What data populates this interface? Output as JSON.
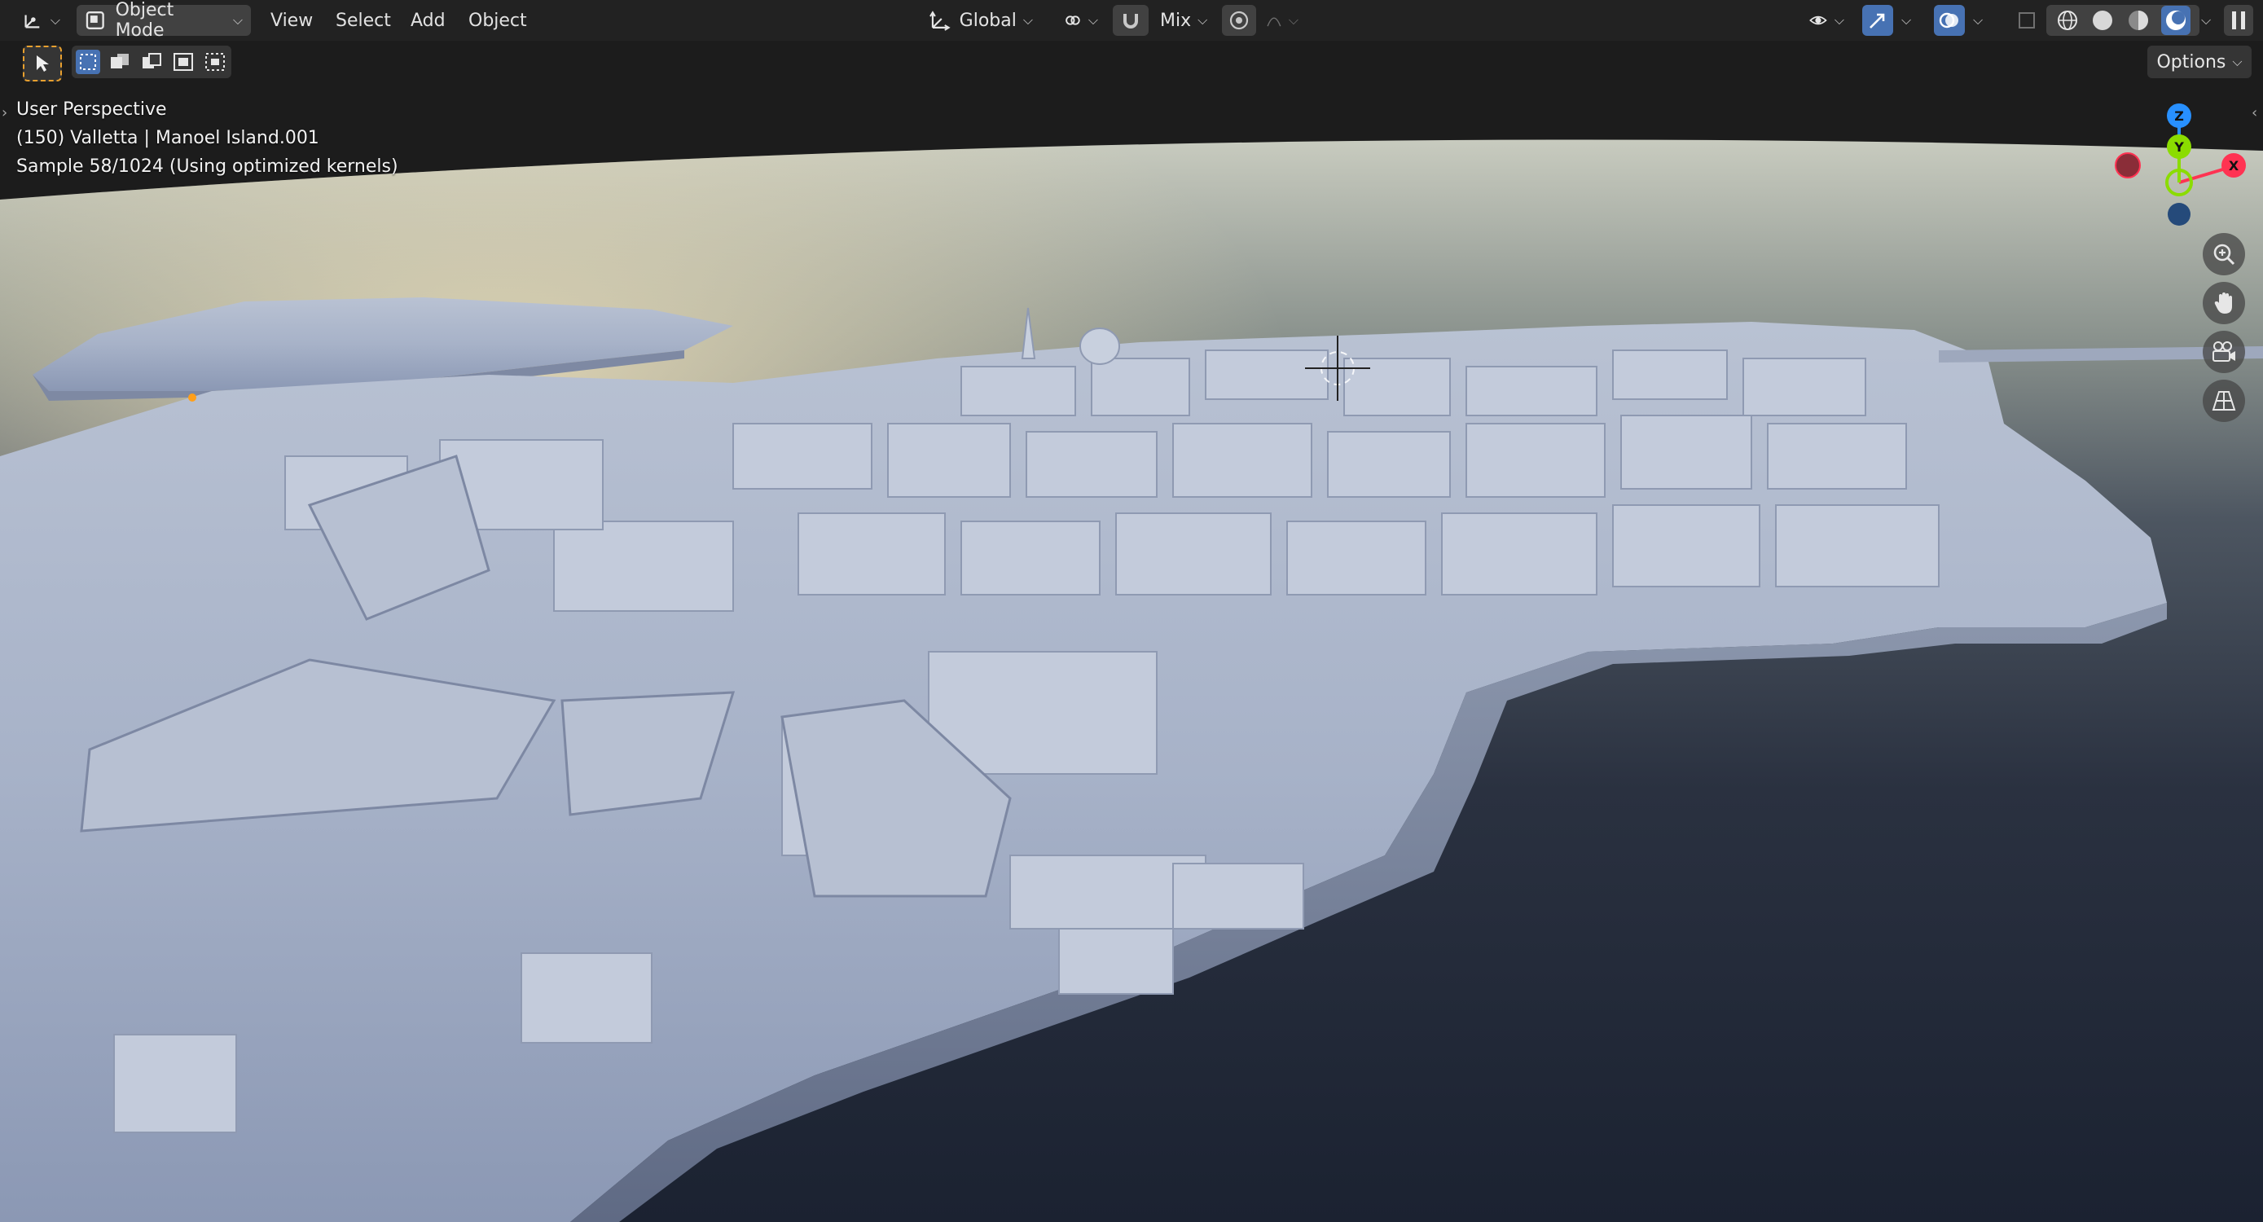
{
  "header": {
    "editor_type_icon": "axes-editor-icon",
    "mode_label": "Object Mode",
    "menus": [
      "View",
      "Select",
      "Add",
      "Object"
    ],
    "transform_orientation": "Global",
    "snap_mode": "Mix",
    "viewport_options_label": "Options"
  },
  "viewport": {
    "view_name": "User Perspective",
    "object_info": "(150) Valletta | Manoel Island.001",
    "render_status": "Sample 58/1024 (Using optimized kernels)"
  },
  "gizmo": {
    "axis_z": "Z",
    "axis_y": "Y",
    "axis_x": "X",
    "colors": {
      "x": "#ff3352",
      "y": "#8bdc00",
      "z": "#2890ff"
    }
  },
  "nav_buttons": [
    "zoom-icon",
    "hand-pan-icon",
    "camera-icon",
    "grid-perspective-icon"
  ],
  "shading_modes": [
    "wireframe",
    "solid",
    "material-preview",
    "rendered"
  ],
  "active_shading": "rendered"
}
